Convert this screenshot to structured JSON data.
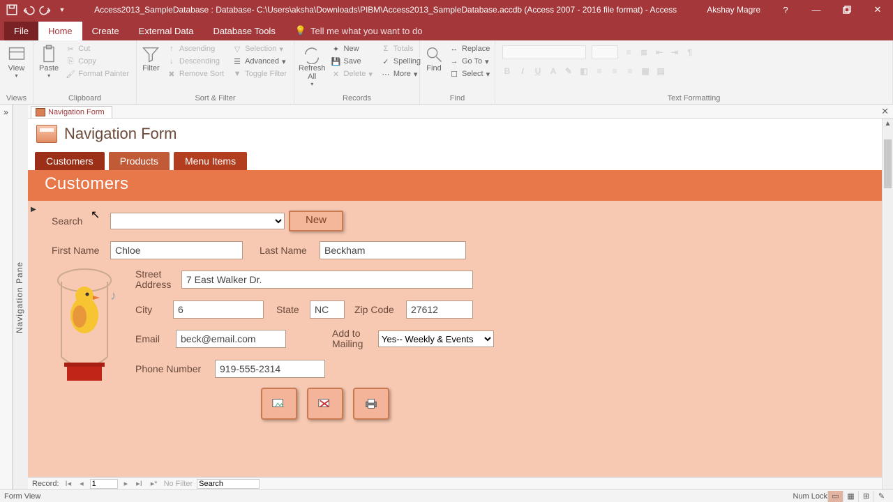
{
  "titlebar": {
    "title": "Access2013_SampleDatabase : Database- C:\\Users\\aksha\\Downloads\\PIBM\\Access2013_SampleDatabase.accdb (Access 2007 - 2016 file format) -  Access",
    "user": "Akshay Magre"
  },
  "menutabs": {
    "file": "File",
    "home": "Home",
    "create": "Create",
    "external": "External Data",
    "dbtools": "Database Tools",
    "tell": "Tell me what you want to do"
  },
  "ribbon": {
    "views": {
      "view": "View",
      "group": "Views"
    },
    "clipboard": {
      "paste": "Paste",
      "cut": "Cut",
      "copy": "Copy",
      "fmt": "Format Painter",
      "group": "Clipboard"
    },
    "sortfilter": {
      "filter": "Filter",
      "asc": "Ascending",
      "desc": "Descending",
      "remove": "Remove Sort",
      "selection": "Selection",
      "advanced": "Advanced",
      "toggle": "Toggle Filter",
      "group": "Sort & Filter"
    },
    "records": {
      "refresh": "Refresh All",
      "new": "New",
      "save": "Save",
      "delete": "Delete",
      "totals": "Totals",
      "spelling": "Spelling",
      "more": "More",
      "group": "Records"
    },
    "find": {
      "find": "Find",
      "replace": "Replace",
      "goto": "Go To",
      "select": "Select",
      "group": "Find"
    },
    "textfmt": {
      "group": "Text Formatting"
    }
  },
  "doctab": {
    "name": "Navigation Form"
  },
  "navpane": "Navigation Pane",
  "navform": {
    "title": "Navigation Form",
    "tabs": {
      "customers": "Customers",
      "products": "Products",
      "menuitems": "Menu Items"
    }
  },
  "customers": {
    "header": "Customers",
    "search_label": "Search",
    "new_btn": "New",
    "first_name_label": "First Name",
    "first_name": "Chloe",
    "last_name_label": "Last Name",
    "last_name": "Beckham",
    "street_label": "Street Address",
    "street": "7 East Walker Dr.",
    "city_label": "City",
    "city": "6",
    "state_label": "State",
    "state": "NC",
    "zip_label": "Zip Code",
    "zip": "27612",
    "email_label": "Email",
    "email": "beck@email.com",
    "mailing_label": "Add to Mailing",
    "mailing_value": "Yes-- Weekly & Events",
    "phone_label": "Phone Number",
    "phone": "919-555-2314"
  },
  "recordnav": {
    "label": "Record:",
    "value": "1",
    "filter": "No Filter",
    "search": "Search"
  },
  "statusbar": {
    "view": "Form View",
    "numlock": "Num Lock"
  }
}
